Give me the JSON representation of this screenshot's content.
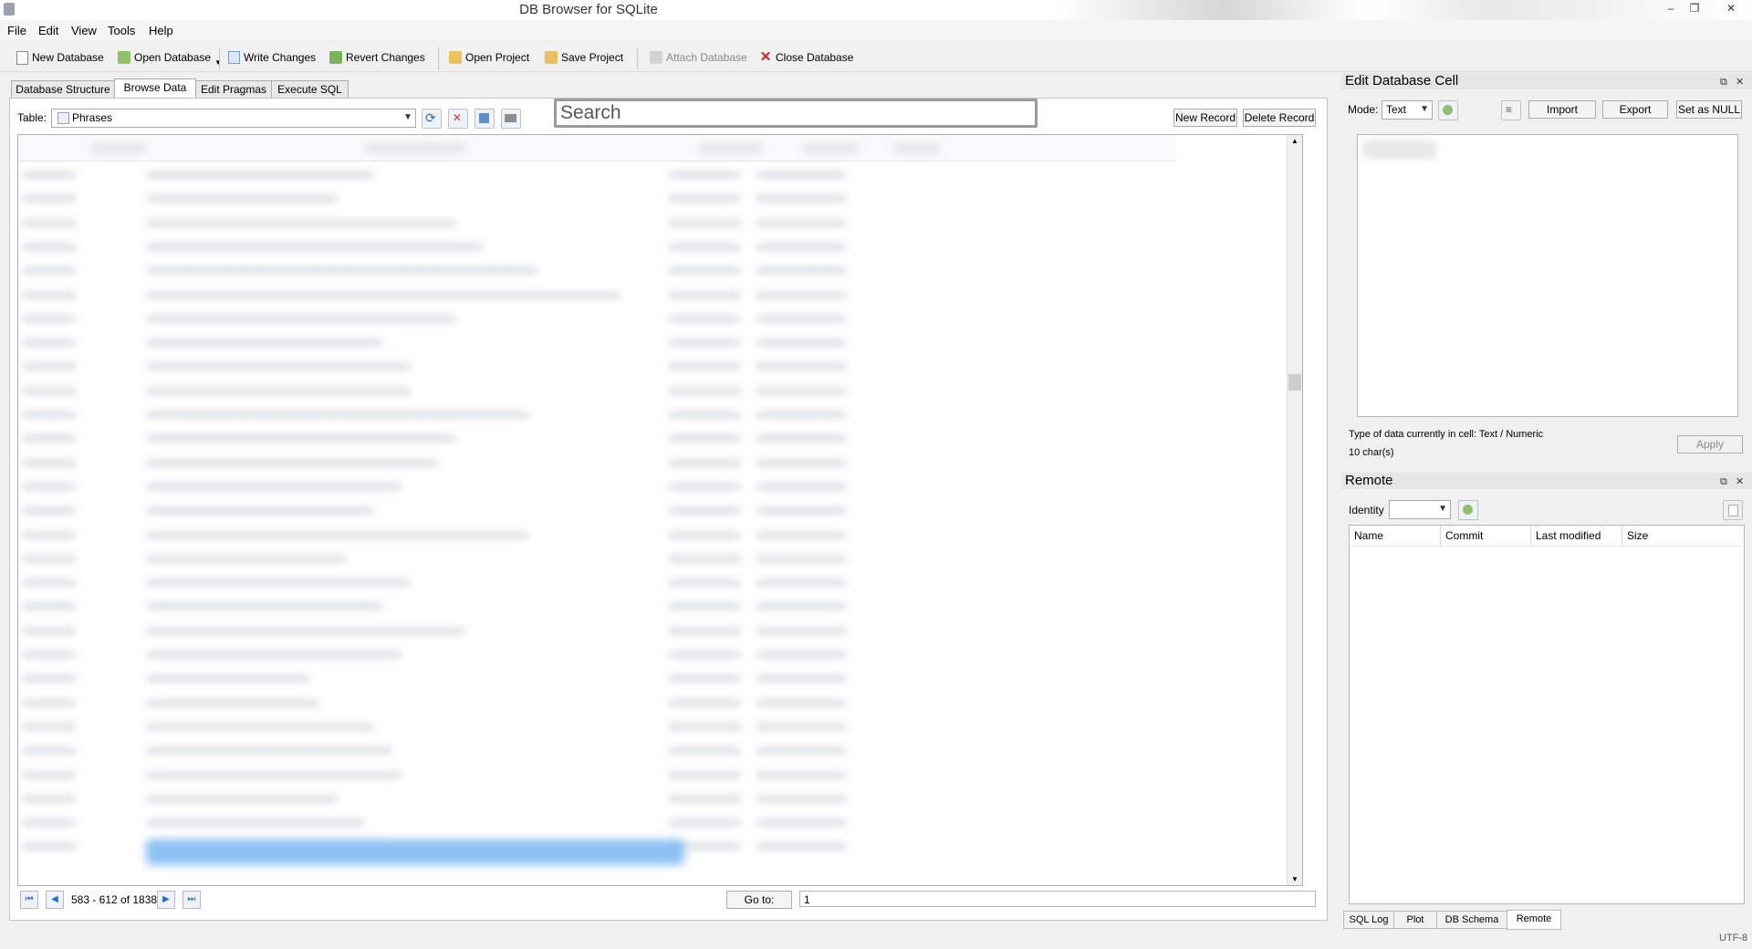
{
  "window": {
    "title": "DB Browser for SQLite",
    "controls": [
      "–",
      "❐",
      "✕"
    ]
  },
  "menu": [
    "File",
    "Edit",
    "View",
    "Tools",
    "Help"
  ],
  "toolbar": {
    "new_database": "New Database",
    "open_database": "Open Database",
    "write_changes": "Write Changes",
    "revert_changes": "Revert Changes",
    "open_project": "Open Project",
    "save_project": "Save Project",
    "attach_database": "Attach Database",
    "close_database": "Close Database"
  },
  "tabs": [
    {
      "label": "Database Structure",
      "active": false
    },
    {
      "label": "Browse Data",
      "active": true
    },
    {
      "label": "Edit Pragmas",
      "active": false
    },
    {
      "label": "Execute SQL",
      "active": false
    }
  ],
  "browse": {
    "table_label": "Table:",
    "table_value": "Phrases",
    "search_placeholder": "Search",
    "new_record": "New Record",
    "delete_record": "Delete Record",
    "page_status": "583 - 612 of 1838",
    "goto_label": "Go to:",
    "goto_value": "1"
  },
  "edit_cell": {
    "title": "Edit Database Cell",
    "mode_label": "Mode:",
    "mode_value": "Text",
    "import": "Import",
    "export": "Export",
    "set_null": "Set as NULL",
    "type_info": "Type of data currently in cell: Text / Numeric",
    "char_count": "10 char(s)",
    "apply": "Apply"
  },
  "remote": {
    "title": "Remote",
    "identity_label": "Identity",
    "columns": [
      "Name",
      "Commit",
      "Last modified",
      "Size"
    ]
  },
  "bottom_tabs": [
    {
      "label": "SQL Log",
      "active": false
    },
    {
      "label": "Plot",
      "active": false
    },
    {
      "label": "DB Schema",
      "active": false
    },
    {
      "label": "Remote",
      "active": true
    }
  ],
  "status": {
    "encoding": "UTF-8"
  },
  "icons": {
    "app": "database-icon",
    "new_database": "new-db-icon",
    "open_database": "open-db-icon",
    "write_changes": "write-icon",
    "revert_changes": "revert-icon",
    "open_project": "open-project-icon",
    "save_project": "save-project-icon",
    "attach_database": "attach-icon",
    "close_database": "close-db-icon"
  },
  "colors": {
    "selection": "#8cc1f5",
    "close_red": "#d32020",
    "accent_blue": "#2a6fcf"
  }
}
